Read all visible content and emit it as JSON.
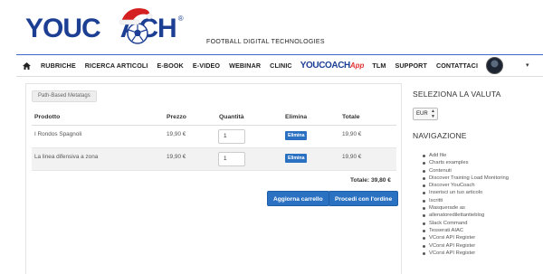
{
  "brand": {
    "logo_text_1": "YOUC",
    "logo_text_2": "ACH",
    "registered": "®",
    "tagline": "FOOTBALL DIGITAL TECHNOLOGIES",
    "primary_color": "#1c3f94",
    "accent_color": "#e0312f"
  },
  "nav": {
    "items": [
      "RUBRICHE",
      "RICERCA ARTICOLI",
      "E-BOOK",
      "E-VIDEO",
      "WEBINAR",
      "CLINIC"
    ],
    "app_label_1": "YOUCOACH",
    "app_label_2": "App",
    "items_after": [
      "TLM",
      "SUPPORT",
      "CONTATTACI"
    ],
    "home_icon": "home-icon",
    "caret": "▾"
  },
  "cart": {
    "breadcrumb": "Path-Based Metatags",
    "headers": {
      "product": "Prodotto",
      "price": "Prezzo",
      "quantity": "Quantità",
      "remove": "Elimina",
      "total": "Totale"
    },
    "rows": [
      {
        "product": "I Rondos Spagnoli",
        "price": "19,90 €",
        "qty": "1",
        "remove": "Elimina",
        "total": "19,90 €"
      },
      {
        "product": "La linea difensiva a zona",
        "price": "19,90 €",
        "qty": "1",
        "remove": "Elimina",
        "total": "19,90 €"
      }
    ],
    "grand_total": "Totale: 39,80 €",
    "update_button": "Aggiorna carrello",
    "checkout_button": "Procedi con l'ordine",
    "button_color": "#2a71c2"
  },
  "sidebar": {
    "currency_title": "SELEZIONA LA VALUTA",
    "currency_value": "EUR",
    "nav_title": "NAVIGAZIONE",
    "links": [
      "Add file",
      "Charts examples",
      "Contenuti",
      "Discover Training Load Monitoring",
      "Discover YouCoach",
      "Inserisci un tuo articolo",
      "Iscritti",
      "Masquerade as",
      "allenatoredilettantieblog",
      "Slack Command",
      "Tesserati AIAC",
      "VCorsi API Register",
      "VCorsi API Register",
      "VCorsi API Register"
    ]
  }
}
